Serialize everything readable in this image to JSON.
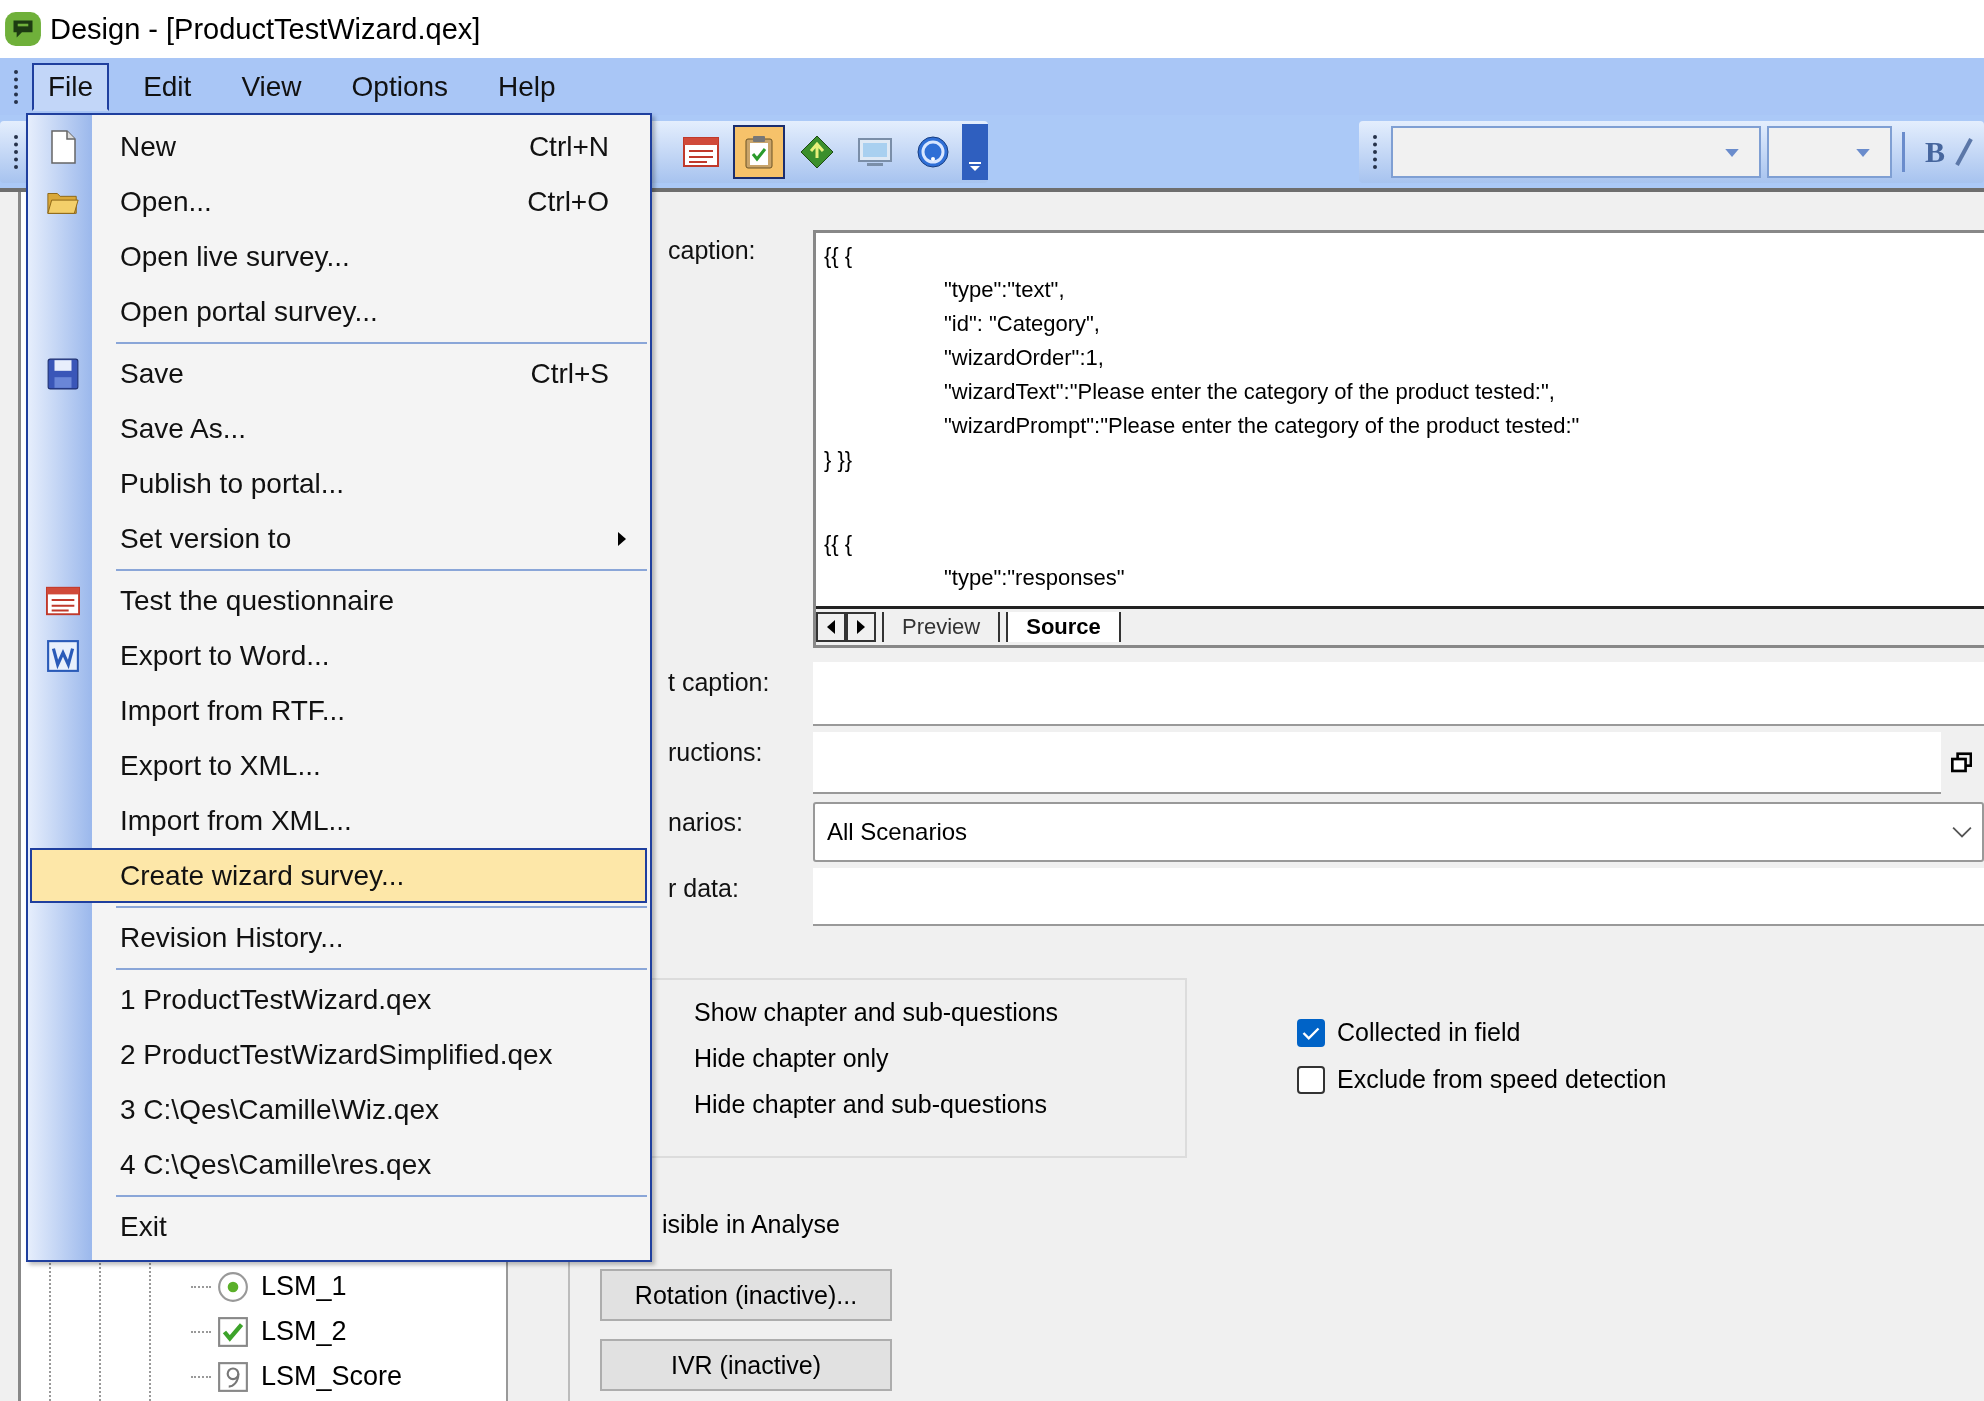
{
  "window": {
    "title": "Design - [ProductTestWizard.qex]"
  },
  "menu_bar": [
    {
      "label": "File",
      "selected": true
    },
    {
      "label": "Edit",
      "selected": false
    },
    {
      "label": "View",
      "selected": false
    },
    {
      "label": "Options",
      "selected": false
    },
    {
      "label": "Help",
      "selected": false
    }
  ],
  "toolbar_buttons": [
    {
      "selected": false
    },
    {
      "selected": true
    },
    {
      "selected": false
    },
    {
      "selected": false
    },
    {
      "selected": false
    }
  ],
  "format_toolbar": {
    "bold": "B"
  },
  "file_menu": [
    {
      "kind": "item",
      "label": "New",
      "shortcut": "Ctrl+N",
      "selected": false
    },
    {
      "kind": "item",
      "label": "Open...",
      "shortcut": "Ctrl+O",
      "selected": false
    },
    {
      "kind": "item",
      "label": "Open live survey...",
      "selected": false
    },
    {
      "kind": "item",
      "label": "Open portal survey...",
      "selected": false
    },
    {
      "kind": "separator"
    },
    {
      "kind": "item",
      "label": "Save",
      "shortcut": "Ctrl+S",
      "selected": false
    },
    {
      "kind": "item",
      "label": "Save As...",
      "selected": false
    },
    {
      "kind": "item",
      "label": "Publish to portal...",
      "selected": false
    },
    {
      "kind": "submenu",
      "label": "Set version to",
      "selected": false
    },
    {
      "kind": "separator"
    },
    {
      "kind": "item",
      "label": "Test the questionnaire",
      "selected": false
    },
    {
      "kind": "item",
      "label": "Export to Word...",
      "selected": false
    },
    {
      "kind": "item",
      "label": "Import from RTF...",
      "selected": false
    },
    {
      "kind": "item",
      "label": "Export to XML...",
      "selected": false
    },
    {
      "kind": "item",
      "label": "Import from XML...",
      "selected": false
    },
    {
      "kind": "item",
      "label": "Create wizard survey...",
      "selected": true
    },
    {
      "kind": "separator"
    },
    {
      "kind": "item",
      "label": "Revision History...",
      "selected": false
    },
    {
      "kind": "separator"
    },
    {
      "kind": "item",
      "label": "1 ProductTestWizard.qex",
      "selected": false
    },
    {
      "kind": "item",
      "label": "2 ProductTestWizardSimplified.qex",
      "selected": false
    },
    {
      "kind": "item",
      "label": "3 C:\\Qes\\Camille\\Wiz.qex",
      "selected": false
    },
    {
      "kind": "item",
      "label": "4 C:\\Qes\\Camille\\res.qex",
      "selected": false
    },
    {
      "kind": "separator"
    },
    {
      "kind": "item",
      "label": "Exit",
      "selected": false
    }
  ],
  "tree": [
    {
      "label": "LSM_1"
    },
    {
      "label": "LSM_2"
    },
    {
      "label": "LSM_Score"
    }
  ],
  "caption": {
    "label": "caption:",
    "blocks": [
      {
        "lines": [
          {
            "text": "{{ {",
            "kind": "brace"
          },
          {
            "text": "\"type\":\"text\",",
            "kind": "property"
          },
          {
            "text": "\"id\": \"Category\",",
            "kind": "property"
          },
          {
            "text": "\"wizardOrder\":1,",
            "kind": "property"
          },
          {
            "text": "\"wizardText\":\"Please enter the category of the product tested:\",",
            "kind": "property"
          },
          {
            "text": "\"wizardPrompt\":\"Please enter the category of the product tested:\"",
            "kind": "property"
          },
          {
            "text": "} }}",
            "kind": "brace"
          }
        ]
      },
      {
        "lines": [
          {
            "text": "{{ {",
            "kind": "brace"
          },
          {
            "text": "\"type\":\"responses\"",
            "kind": "property"
          }
        ]
      }
    ],
    "tabs": [
      {
        "label": "Preview",
        "selected": false
      },
      {
        "label": "Source",
        "selected": true
      }
    ]
  },
  "short_caption": {
    "label": "t caption:"
  },
  "instructions": {
    "label": "ructions:"
  },
  "scenarios": {
    "label": "narios:",
    "value": "All Scenarios"
  },
  "other_data": {
    "label": "r data:"
  },
  "display_options": [
    "Show chapter and sub-questions",
    "Hide chapter only",
    "Hide chapter and sub-questions"
  ],
  "checkboxes": [
    {
      "label": "Collected in field",
      "checked": true
    },
    {
      "label": "Exclude from speed detection",
      "checked": false
    }
  ],
  "visible_in_analyse": {
    "label": "isible in Analyse"
  },
  "buttons": [
    "Rotation (inactive)...",
    "IVR (inactive)"
  ]
}
